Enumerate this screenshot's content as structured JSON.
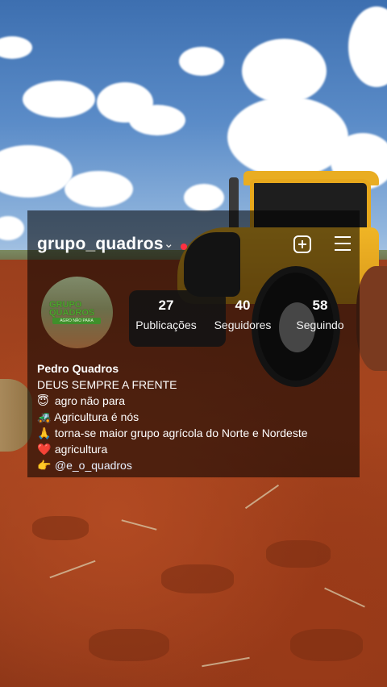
{
  "profile": {
    "username": "grupo_quadros",
    "avatar_text_line1": "GRUPO",
    "avatar_text_line2": "QUADROS",
    "avatar_tagline": "AGRO NÃO PARA",
    "stats": {
      "posts": {
        "value": "27",
        "label": "Publicações"
      },
      "followers": {
        "value": "40",
        "label": "Seguidores"
      },
      "following": {
        "value": "58",
        "label": "Seguindo"
      }
    },
    "bio": {
      "name": "Pedro Quadros",
      "lines": [
        {
          "icon": "",
          "text": "DEUS SEMPRE A FRENTE"
        },
        {
          "icon": "😇",
          "text": "agro não para"
        },
        {
          "icon": "🚜",
          "text": "Agricultura é nós"
        },
        {
          "icon": "🙏",
          "text": "torna-se maior grupo agrícola do Norte e Nordeste"
        },
        {
          "icon": "❤️",
          "text": "agricultura"
        },
        {
          "icon": "👉",
          "text": "@e_o_quadros"
        }
      ]
    }
  },
  "icons": {
    "username_chevron": "chevron-down-icon",
    "notification_dot": "notification-dot",
    "create": "plus-square-icon",
    "menu": "hamburger-menu-icon"
  },
  "colors": {
    "overlay": "#000000",
    "notification_dot": "#ff3040",
    "text": "#ffffff"
  }
}
